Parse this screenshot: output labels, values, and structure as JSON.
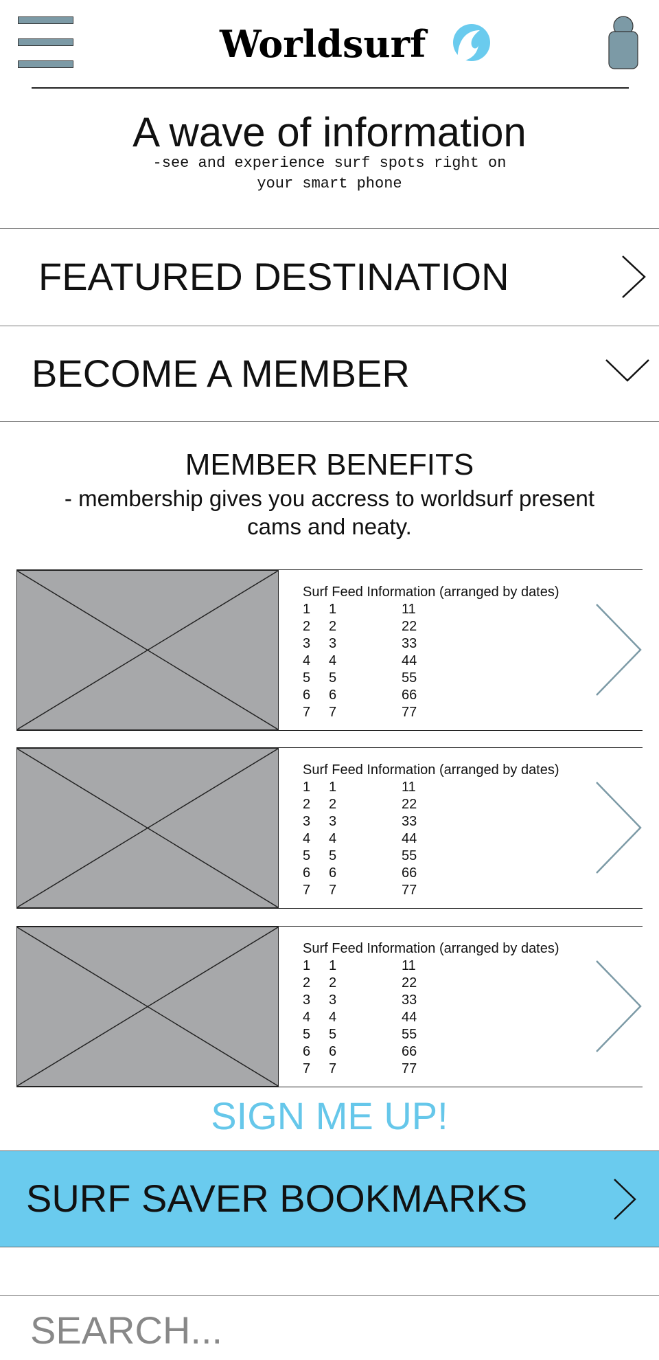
{
  "header": {
    "logo_text": "Worldsurf",
    "menu_icon": "hamburger-menu-icon",
    "account_icon": "user-account-icon",
    "brand_color": "#6acbee",
    "icon_color": "#7c9aa6"
  },
  "hero": {
    "title": "A wave of information",
    "subtitle": "-see and experience surf spots right on your smart phone"
  },
  "sections": {
    "featured": "FEATURED DESTINATION",
    "member": "BECOME A MEMBER"
  },
  "benefits": {
    "title": "MEMBER BENEFITS",
    "description": "- membership gives you accress to worldsurf present cams and neaty."
  },
  "cards": [
    {
      "heading": "Surf Feed Information (arranged by dates)",
      "rows": [
        [
          "1",
          "1",
          "11"
        ],
        [
          "2",
          "2",
          "22"
        ],
        [
          "3",
          "3",
          "33"
        ],
        [
          "4",
          "4",
          "44"
        ],
        [
          "5",
          "5",
          "55"
        ],
        [
          "6",
          "6",
          "66"
        ],
        [
          "7",
          "7",
          "77"
        ]
      ]
    },
    {
      "heading": "Surf Feed Information (arranged by dates)",
      "rows": [
        [
          "1",
          "1",
          "11"
        ],
        [
          "2",
          "2",
          "22"
        ],
        [
          "3",
          "3",
          "33"
        ],
        [
          "4",
          "4",
          "44"
        ],
        [
          "5",
          "5",
          "55"
        ],
        [
          "6",
          "6",
          "66"
        ],
        [
          "7",
          "7",
          "77"
        ]
      ]
    },
    {
      "heading": "Surf Feed Information (arranged by dates)",
      "rows": [
        [
          "1",
          "1",
          "11"
        ],
        [
          "2",
          "2",
          "22"
        ],
        [
          "3",
          "3",
          "33"
        ],
        [
          "4",
          "4",
          "44"
        ],
        [
          "5",
          "5",
          "55"
        ],
        [
          "6",
          "6",
          "66"
        ],
        [
          "7",
          "7",
          "77"
        ]
      ]
    }
  ],
  "signup_label": "SIGN ME UP!",
  "bookmarks_label": "SURF SAVER BOOKMARKS",
  "search": {
    "placeholder": "SEARCH..."
  }
}
